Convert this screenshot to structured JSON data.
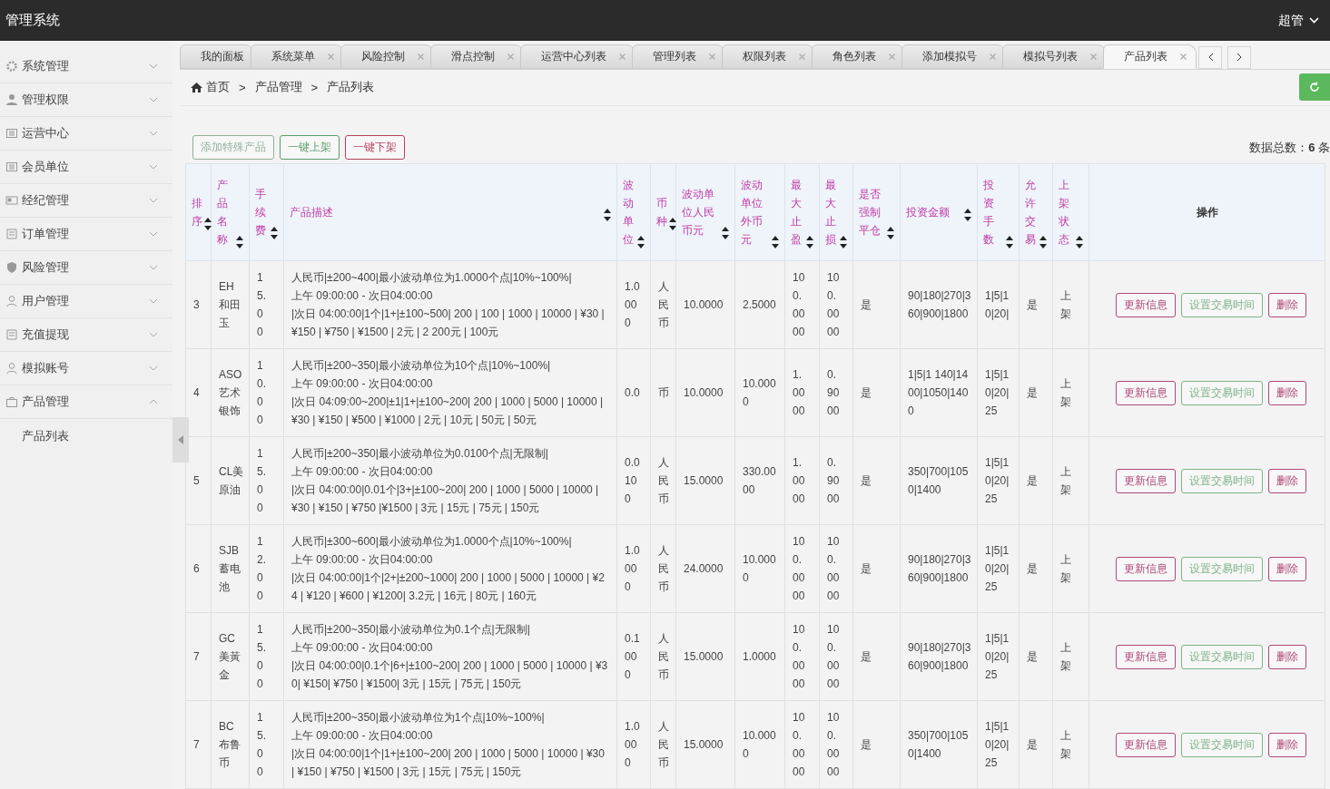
{
  "header": {
    "title": "管理系统",
    "user": "超管"
  },
  "sidebar": {
    "items": [
      {
        "label": "系统管理",
        "expanded": false
      },
      {
        "label": "管理权限",
        "expanded": false
      },
      {
        "label": "运营中心",
        "expanded": false
      },
      {
        "label": "会员单位",
        "expanded": false
      },
      {
        "label": "经纪管理",
        "expanded": false
      },
      {
        "label": "订单管理",
        "expanded": false
      },
      {
        "label": "风险管理",
        "expanded": false
      },
      {
        "label": "用户管理",
        "expanded": false
      },
      {
        "label": "充值提现",
        "expanded": false
      },
      {
        "label": "模拟账号",
        "expanded": false
      },
      {
        "label": "产品管理",
        "expanded": true,
        "children": [
          {
            "label": "产品列表"
          }
        ]
      }
    ]
  },
  "tabs": [
    {
      "label": "我的面板",
      "selected": false,
      "closable": false
    },
    {
      "label": "系统菜单",
      "selected": false,
      "closable": true
    },
    {
      "label": "风险控制",
      "selected": false,
      "closable": true
    },
    {
      "label": "滑点控制",
      "selected": false,
      "closable": true
    },
    {
      "label": "运营中心列表",
      "selected": false,
      "closable": true
    },
    {
      "label": "管理列表",
      "selected": false,
      "closable": true
    },
    {
      "label": "权限列表",
      "selected": false,
      "closable": true
    },
    {
      "label": "角色列表",
      "selected": false,
      "closable": true
    },
    {
      "label": "添加模拟号",
      "selected": false,
      "closable": true
    },
    {
      "label": "模拟号列表",
      "selected": false,
      "closable": true
    },
    {
      "label": "产品列表",
      "selected": true,
      "closable": true
    }
  ],
  "breadcrumb": {
    "items": [
      "首页",
      "产品管理",
      "产品列表"
    ],
    "separators": [
      ">",
      ">"
    ]
  },
  "toolbar": {
    "buttons": [
      {
        "label": "添加特殊产品",
        "kind": "muted"
      },
      {
        "label": "一键上架",
        "kind": "success"
      },
      {
        "label": "一键下架",
        "kind": "danger"
      }
    ],
    "total": "数据总数：**6** 条"
  },
  "table": {
    "columns": [
      {
        "label": "排序",
        "sortable": true
      },
      {
        "label": "产品名称",
        "sortable": true
      },
      {
        "label": "手续费",
        "sortable": true
      },
      {
        "label": "产品描述",
        "sortable": true
      },
      {
        "label": "波动单位",
        "sortable": true
      },
      {
        "label": "币种",
        "sortable": true
      },
      {
        "label": "波动单位人民币元",
        "sortable": true
      },
      {
        "label": "波动单位外币元",
        "sortable": true
      },
      {
        "label": "最大止盈",
        "sortable": true
      },
      {
        "label": "最大止损",
        "sortable": true
      },
      {
        "label": "是否强制平仓",
        "sortable": true
      },
      {
        "label": "投资金额",
        "sortable": true
      },
      {
        "label": "投资手数",
        "sortable": true
      },
      {
        "label": "允许交易",
        "sortable": true
      },
      {
        "label": "上架状态",
        "sortable": true
      },
      {
        "label": "操作",
        "sortable": false
      }
    ],
    "rows": [
      {
        "cells": [
          "3",
          "EH和田玉",
          "15.00"
        ],
        "description": [
          "人民币|±200~400|最小波动单位为1.0000个点|10%~100%|",
          "上午 09:00:00 - 次日04:00:00",
          "|次日 04:00:00|1个|1+|±100~500| 200 | 100 | 1000 | 10000 | ¥30 | ¥150 | ¥750 | ¥1500 | 2元 | 2 200元 | 100元"
        ],
        "values": [
          "1.0000",
          "人民币",
          "10.0000",
          "2.5000",
          "100.0000",
          "100.0000",
          "是",
          "90|180|270|360|900|1800",
          "1|5|10|20|",
          "是",
          "上架"
        ],
        "actions": [
          {
            "label": "更新信息",
            "kind": "edit"
          },
          {
            "label": "设置交易时间",
            "kind": "time"
          },
          {
            "label": "删除",
            "kind": "delete"
          }
        ]
      },
      {
        "cells": [
          "4",
          "ASO艺术银饰",
          "10.00"
        ],
        "description": [
          "人民币|±200~350|最小波动单位为10个点|10%~100%|",
          "上午 09:00:00 - 次日04:00:00",
          "|次日 04:09:00~200|±1|1+|±100~200| 200 | 1000 | 5000 | 10000 | ¥30 | ¥150 | ¥500 | ¥1000 | 2元 | 10元 | 50元 | 50元"
        ],
        "values": [
          "0.0",
          "币",
          "10.0000",
          "10.0000",
          "1.0000",
          "0.9000",
          "是",
          "1|5|1 140|1400|1050|1400",
          "1|5|10|20|25",
          "是",
          "上架"
        ],
        "actions": [
          {
            "label": "更新信息",
            "kind": "edit"
          },
          {
            "label": "设置交易时间",
            "kind": "time"
          },
          {
            "label": "删除",
            "kind": "delete"
          }
        ]
      },
      {
        "cells": [
          "5",
          "CL美原油",
          "15.00"
        ],
        "description": [
          "人民币|±200~350|最小波动单位为0.0100个点|无限制|",
          "上午 09:00:00 - 次日04:00:00",
          "|次日 04:00:00|0.01个|3+|±100~200| 200 | 1000 | 5000 | 10000 | ¥30 | ¥150 | ¥750 |¥1500 | 3元 | 15元 | 75元 | 150元"
        ],
        "values": [
          "0.0100",
          "人民币",
          "15.0000",
          "330.0000",
          "1.0000",
          "0.9000",
          "是",
          "350|700|1050|1400",
          "1|5|10|20|25",
          "是",
          "上架"
        ],
        "actions": [
          {
            "label": "更新信息",
            "kind": "edit"
          },
          {
            "label": "设置交易时间",
            "kind": "time"
          },
          {
            "label": "删除",
            "kind": "delete"
          }
        ]
      },
      {
        "cells": [
          "6",
          "SJB蓄电池",
          "12.00"
        ],
        "description": [
          "人民币|±300~600|最小波动单位为1.0000个点|10%~100%|",
          "上午 09:00:00 - 次日04:00:00",
          "|次日 04:00:00|1个|2+|±200~1000| 200 | 1000 | 5000 | 10000 | ¥24 | ¥120 | ¥600 | ¥1200| 3.2元 | 16元 | 80元 | 160元"
        ],
        "values": [
          "1.0000",
          "人民币",
          "24.0000",
          "10.0000",
          "100.0000",
          "100.0000",
          "是",
          "90|180|270|360|900|1800",
          "1|5|10|20|25",
          "是",
          "上架"
        ],
        "actions": [
          {
            "label": "更新信息",
            "kind": "edit"
          },
          {
            "label": "设置交易时间",
            "kind": "time"
          },
          {
            "label": "删除",
            "kind": "delete"
          }
        ]
      },
      {
        "cells": [
          "7",
          "GC美黃金",
          "15.00"
        ],
        "description": [
          "人民币|±200~350|最小波动单位为0.1个点|无限制|",
          "上午 09:00:00 - 次日04:00:00",
          "|次日 04:00:00|0.1个|6+|±100~200| 200 | 1000 | 5000 | 10000 | ¥30| ¥150| ¥750 | ¥1500| 3元 | 15元 | 75元 | 150元"
        ],
        "values": [
          "0.1000",
          "人民币",
          "15.0000",
          "1.0000",
          "100.0000",
          "100.0000",
          "是",
          "90|180|270|360|900|1800",
          "1|5|10|20|25",
          "是",
          "上架"
        ],
        "actions": [
          {
            "label": "更新信息",
            "kind": "edit"
          },
          {
            "label": "设置交易时间",
            "kind": "time"
          },
          {
            "label": "删除",
            "kind": "delete"
          }
        ]
      },
      {
        "cells": [
          "7",
          "BC布鲁币",
          "15.00"
        ],
        "description": [
          "人民币|±200~350|最小波动单位为1个点|10%~100%|",
          "上午 09:00:00 - 次日04:00:00",
          "|次日 04:00:00|1个|1+|±100~200| 200 | 1000 | 5000 | 10000 | ¥30 | ¥150 | ¥750 | ¥1500 | 3元 | 15元 | 75元 | 150元"
        ],
        "values": [
          "1.0000",
          "人民币",
          "15.0000",
          "10.0000",
          "100.0000",
          "100.0000",
          "是",
          "350|700|1050|1400",
          "1|5|10|20|25",
          "是",
          "上架"
        ],
        "actions": [
          {
            "label": "更新信息",
            "kind": "edit"
          },
          {
            "label": "设置交易时间",
            "kind": "time"
          },
          {
            "label": "删除",
            "kind": "delete"
          }
        ]
      }
    ]
  }
}
